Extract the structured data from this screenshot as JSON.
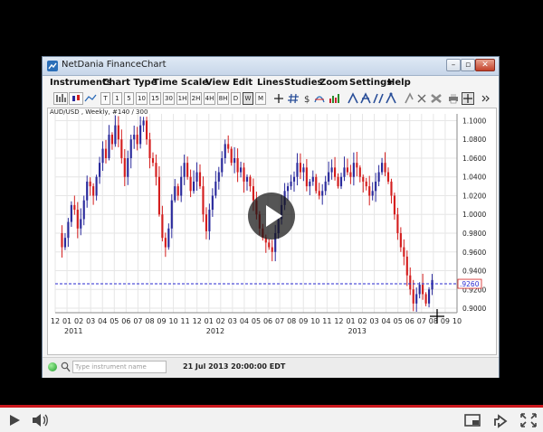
{
  "window": {
    "title": "NetDania FinanceChart",
    "buttons": {
      "minimize": "–",
      "restore": "▫",
      "close": "✕"
    }
  },
  "menu": [
    "Instruments",
    "Chart Type",
    "Time Scale",
    "View",
    "Edit",
    "Lines",
    "Studies",
    "Zoom",
    "Settings",
    "Help"
  ],
  "toolbar": {
    "timescales": [
      "T",
      "1",
      "5",
      "10",
      "15",
      "30",
      "1H",
      "2H",
      "4H",
      "8H",
      "D",
      "W",
      "M"
    ],
    "active_timescale": "W"
  },
  "chart": {
    "label": "AUD/USD , Weekly, #140 / 300",
    "price_tag": ".9260"
  },
  "status": {
    "symbol_placeholder": "Type instrument name",
    "datetime": "21 Jul 2013 20:00:00 EDT"
  },
  "colors": {
    "up": "#2a2a9c",
    "down": "#d41e1e",
    "accent": "#cc181e"
  },
  "icons": [
    "cursor-icon",
    "crosshair-icon",
    "zoom-icon",
    "bar-chart-icon",
    "line-tool-icon",
    "eraser-icon",
    "print-icon",
    "play-icon",
    "volume-icon",
    "fullscreen-icon",
    "settings-icon",
    "captions-icon"
  ],
  "chart_data": {
    "type": "candlestick",
    "title": "AUD/USD , Weekly, #140 / 300",
    "y_ticks": [
      "1.1000",
      "1.0800",
      "1.0600",
      "1.0400",
      "1.0200",
      "1.0000",
      "0.9800",
      "0.9600",
      "0.9400",
      "0.9200",
      "0.9000"
    ],
    "ylim": [
      0.8952,
      1.1072
    ],
    "x_ticks": [
      "12",
      "01",
      "02",
      "03",
      "04",
      "05",
      "06",
      "07",
      "08",
      "09",
      "10",
      "11",
      "12",
      "01",
      "02",
      "03",
      "04",
      "05",
      "06",
      "07",
      "08",
      "09",
      "10",
      "11",
      "12",
      "01",
      "02",
      "03",
      "04",
      "05",
      "06",
      "07",
      "08",
      "09",
      "10"
    ],
    "year_labels": [
      {
        "label": "2011",
        "at_tick": 1
      },
      {
        "label": "2012",
        "at_tick": 13
      },
      {
        "label": "2013",
        "at_tick": 25
      }
    ],
    "reference_line": 0.926,
    "closes": [
      0.98,
      0.965,
      0.975,
      0.992,
      1.01,
      1.005,
      0.985,
      0.995,
      1.015,
      1.035,
      1.03,
      1.02,
      1.04,
      1.055,
      1.07,
      1.06,
      1.085,
      1.075,
      1.095,
      1.08,
      1.06,
      1.04,
      1.06,
      1.08,
      1.085,
      1.075,
      1.095,
      1.1,
      1.08,
      1.06,
      1.055,
      1.04,
      1.0,
      0.975,
      0.965,
      0.985,
      1.015,
      1.03,
      1.02,
      1.04,
      1.055,
      1.04,
      1.025,
      1.035,
      1.045,
      1.03,
      1.0,
      0.982,
      1.005,
      1.02,
      1.035,
      1.045,
      1.06,
      1.075,
      1.07,
      1.055,
      1.06,
      1.045,
      1.05,
      1.035,
      1.04,
      1.03,
      1.015,
      1.0,
      0.985,
      0.975,
      0.97,
      0.965,
      0.96,
      0.98,
      0.995,
      1.01,
      1.025,
      1.03,
      1.035,
      1.04,
      1.055,
      1.045,
      1.05,
      1.03,
      1.035,
      1.04,
      1.025,
      1.02,
      1.025,
      1.035,
      1.045,
      1.05,
      1.04,
      1.03,
      1.04,
      1.05,
      1.045,
      1.04,
      1.055,
      1.05,
      1.04,
      1.035,
      1.03,
      1.02,
      1.025,
      1.035,
      1.045,
      1.055,
      1.045,
      1.035,
      1.02,
      1.0,
      0.98,
      0.965,
      0.955,
      0.935,
      0.92,
      0.905,
      0.915,
      0.925,
      0.915,
      0.905,
      0.92,
      0.93
    ]
  }
}
